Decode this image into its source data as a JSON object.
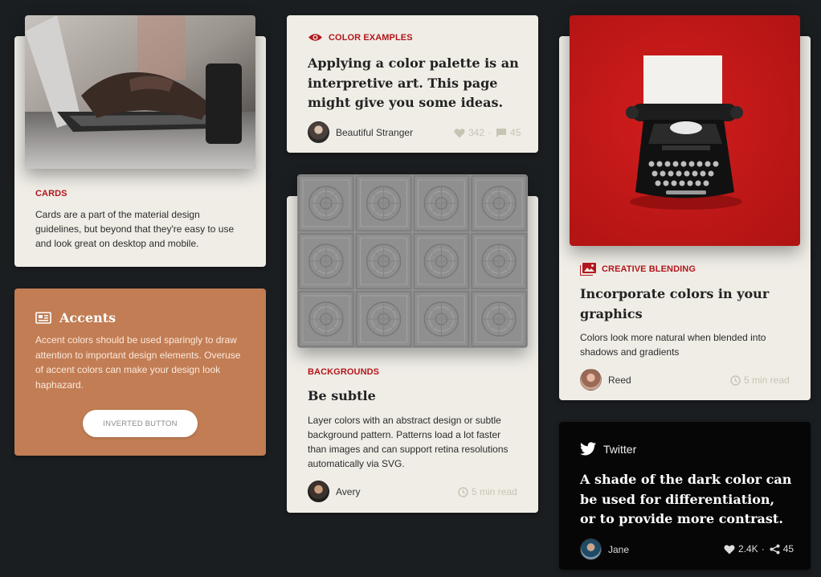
{
  "cards_card": {
    "kicker": "Cards",
    "text": "Cards are a part of the material design guidelines, but beyond that they're easy to use and look great on desktop and mobile."
  },
  "accents_card": {
    "title": "Accents",
    "text": "Accent colors should be used sparingly to draw attention to important design elements. Overuse of accent colors can make your design look haphazard.",
    "button_label": "INVERTED BUTTON"
  },
  "color_examples_card": {
    "kicker": "Color Examples",
    "headline": "Applying a color palette is an interpretive art. This page might give you some ideas.",
    "author": "Beautiful Stranger",
    "likes": "342",
    "separator": "·",
    "comments": "45"
  },
  "backgrounds_card": {
    "kicker": "Backgrounds",
    "headline": "Be subtle",
    "text": "Layer colors with an abstract design or subtle background pattern. Patterns load a lot faster than images and can support retina resolutions automatically via SVG.",
    "author": "Avery",
    "read_time": "5 min read"
  },
  "creative_card": {
    "kicker": "Creative Blending",
    "headline": "Incorporate colors in your graphics",
    "text": "Colors look more natural when blended into shadows and gradients",
    "author": "Reed",
    "read_time": "5 min read"
  },
  "twitter_card": {
    "source": "Twitter",
    "headline": "A shade of the dark color can be used for differentiation, or to provide more contrast.",
    "author": "Jane",
    "likes": "2.4K",
    "separator": "·",
    "shares": "45"
  },
  "colors": {
    "page_bg": "#1b1e21",
    "card_bg": "#efede6",
    "accent_red": "#b3161c",
    "accent_card": "#c27d54",
    "twitter_bg": "#060606"
  },
  "icons": [
    "eye-icon",
    "newspaper-icon",
    "image-icon",
    "twitter-bird-icon",
    "heart-icon",
    "comment-icon",
    "clock-icon",
    "share-icon"
  ]
}
